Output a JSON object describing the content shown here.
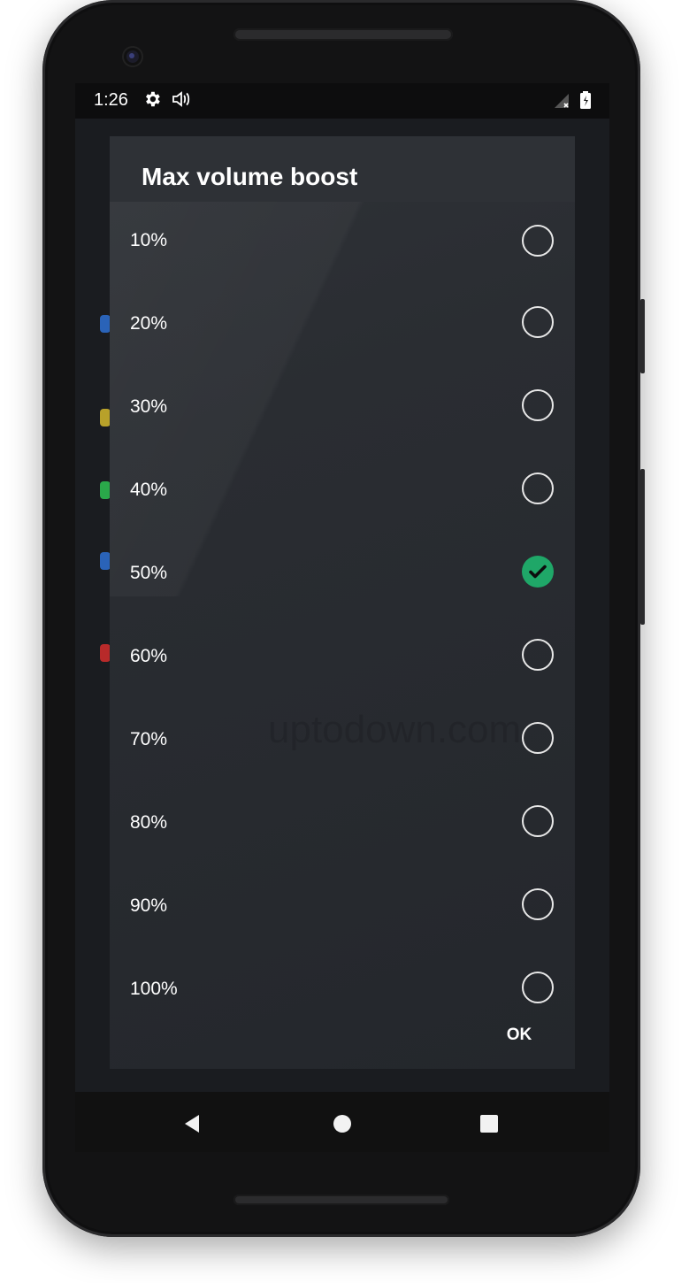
{
  "status_bar": {
    "time": "1:26",
    "icons": [
      "settings-icon",
      "volume-icon",
      "signal-icon",
      "battery-icon"
    ]
  },
  "dialog": {
    "title": "Max volume boost",
    "partial_top_label": "10%",
    "options": [
      {
        "label": "20%",
        "checked": false
      },
      {
        "label": "30%",
        "checked": false
      },
      {
        "label": "40%",
        "checked": false
      },
      {
        "label": "50%",
        "checked": true
      },
      {
        "label": "60%",
        "checked": false
      },
      {
        "label": "70%",
        "checked": false
      },
      {
        "label": "80%",
        "checked": false
      },
      {
        "label": "90%",
        "checked": false
      },
      {
        "label": "100%",
        "checked": false
      }
    ],
    "ok_label": "OK"
  },
  "watermark": "uptodown.com",
  "colors": {
    "accent": "#1fa768",
    "dialog_bg": "#24272c",
    "text": "#ffffff"
  },
  "navigation": {
    "buttons": [
      "back-icon",
      "home-icon",
      "recents-icon"
    ]
  }
}
